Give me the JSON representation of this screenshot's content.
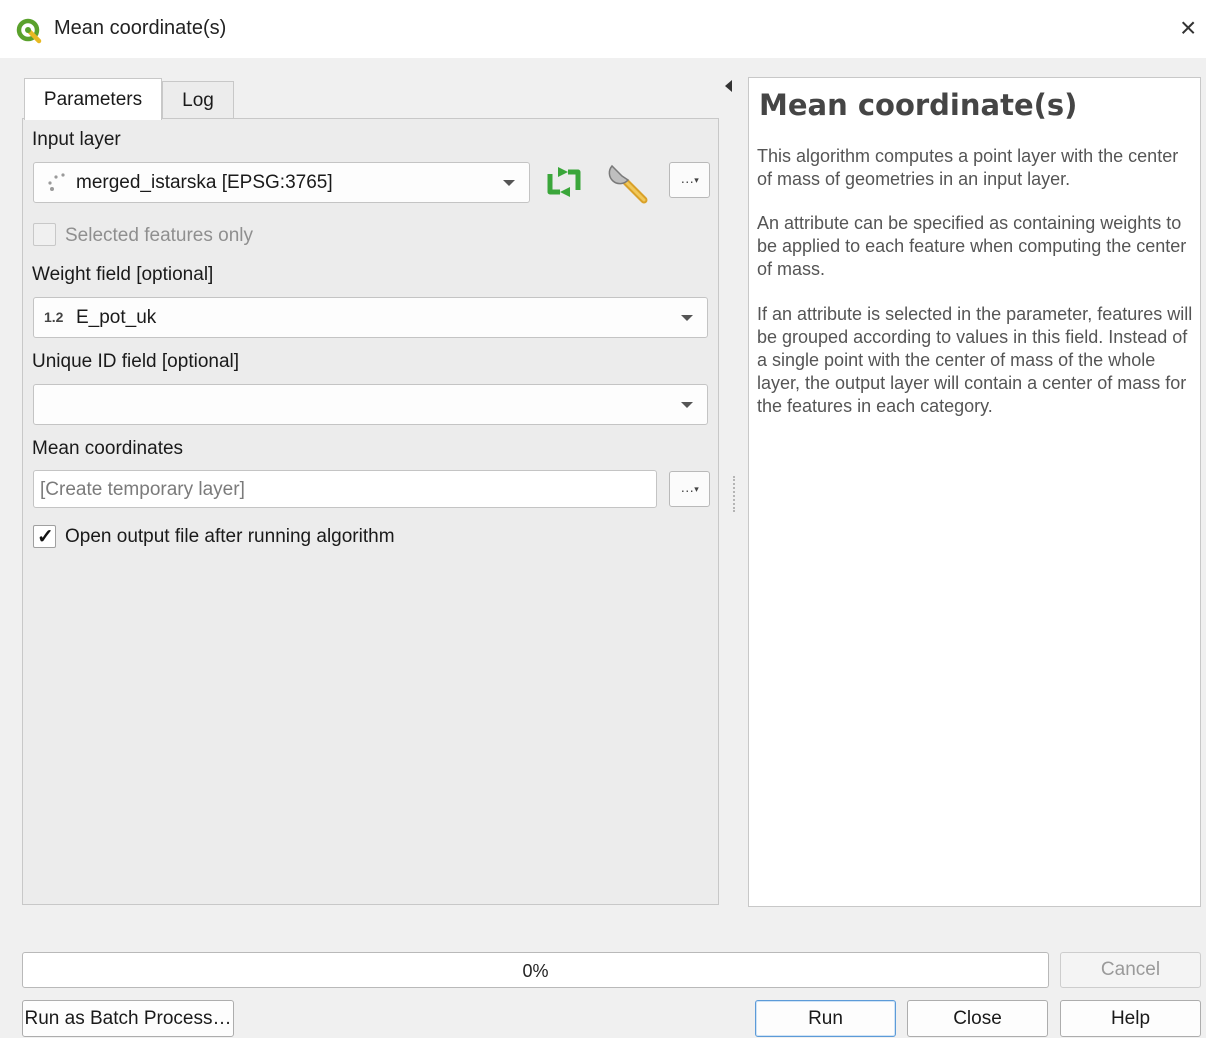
{
  "window": {
    "title": "Mean coordinate(s)",
    "close_glyph": "×",
    "icon": "qgis-logo-icon"
  },
  "tabs": [
    {
      "label": "Parameters",
      "active": true
    },
    {
      "label": "Log",
      "active": false
    }
  ],
  "params": {
    "input_layer": {
      "label": "Input layer",
      "value": "merged_istarska [EPSG:3765]",
      "iterate_icon": "iterate-icon",
      "advanced_icon": "wrench-icon",
      "more_button": "…"
    },
    "selected_only": {
      "label": "Selected features only",
      "checked": false,
      "enabled": false
    },
    "weight_field": {
      "label": "Weight field [optional]",
      "type_badge": "1.2",
      "value": "E_pot_uk"
    },
    "unique_id_field": {
      "label": "Unique ID field [optional]",
      "value": ""
    },
    "mean_coordinates": {
      "label": "Mean coordinates",
      "placeholder": "[Create temporary layer]",
      "more_button": "…"
    },
    "open_output": {
      "label": "Open output file after running algorithm",
      "checked": true,
      "check_glyph": "✓"
    }
  },
  "help": {
    "title": "Mean coordinate(s)",
    "paragraphs": [
      "This algorithm computes a point layer with the center of mass of geometries in an input layer.",
      "An attribute can be specified as containing weights to be applied to each feature when computing the center of mass.",
      "If an attribute is selected in the parameter, features will be grouped according to values in this field. Instead of a single point with the center of mass of the whole layer, the output layer will contain a center of mass for the features in each category."
    ]
  },
  "progress": {
    "percent": 0,
    "text": "0%"
  },
  "buttons": {
    "cancel": "Cancel",
    "batch": "Run as Batch Process…",
    "run": "Run",
    "close": "Close",
    "help": "Help"
  },
  "colors": {
    "accent": "#5c9bd8",
    "iterate_green": "#3aa63a",
    "progress_fill": "#06b025"
  }
}
